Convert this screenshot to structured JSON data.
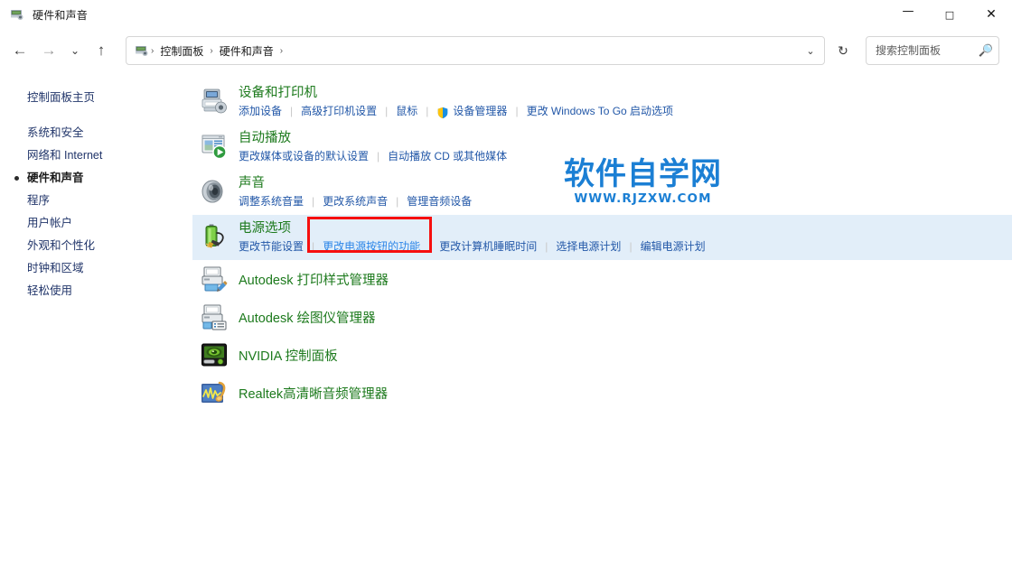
{
  "window": {
    "title": "硬件和声音",
    "icon": "control-panel-icon",
    "controls": {
      "minimize": "—",
      "maximize": "□",
      "close": "✕"
    }
  },
  "navbar": {
    "back": "←",
    "forward": "→",
    "recent": "⌄",
    "up": "↑",
    "address": {
      "icon": "control-panel-icon",
      "crumbs": [
        "控制面板",
        "硬件和声音"
      ],
      "separator": "›",
      "trailing_separator": "›",
      "dropdown": "⌄"
    },
    "refresh": "↻",
    "search": {
      "placeholder": "搜索控制面板",
      "value": "",
      "icon": "search-icon"
    }
  },
  "sidebar": {
    "home": "控制面板主页",
    "items": [
      {
        "label": "系统和安全",
        "current": false
      },
      {
        "label": "网络和 Internet",
        "current": false
      },
      {
        "label": "硬件和声音",
        "current": true
      },
      {
        "label": "程序",
        "current": false
      },
      {
        "label": "用户帐户",
        "current": false
      },
      {
        "label": "外观和个性化",
        "current": false
      },
      {
        "label": "时钟和区域",
        "current": false
      },
      {
        "label": "轻松使用",
        "current": false
      }
    ]
  },
  "main": {
    "categories": [
      {
        "icon": "devices-and-printers-icon",
        "title": "设备和打印机",
        "links": [
          {
            "label": "添加设备",
            "shield": false
          },
          {
            "label": "高级打印机设置",
            "shield": false
          },
          {
            "label": "鼠标",
            "shield": false
          },
          {
            "label": "设备管理器",
            "shield": true
          },
          {
            "label": "更改 Windows To Go 启动选项",
            "shield": false
          }
        ],
        "highlight": false
      },
      {
        "icon": "autoplay-icon",
        "title": "自动播放",
        "links": [
          {
            "label": "更改媒体或设备的默认设置",
            "shield": false
          },
          {
            "label": "自动播放 CD 或其他媒体",
            "shield": false
          }
        ],
        "highlight": false
      },
      {
        "icon": "sound-icon",
        "title": "声音",
        "links": [
          {
            "label": "调整系统音量",
            "shield": false
          },
          {
            "label": "更改系统声音",
            "shield": false
          },
          {
            "label": "管理音频设备",
            "shield": false
          }
        ],
        "highlight": false
      },
      {
        "icon": "power-options-icon",
        "title": "电源选项",
        "links": [
          {
            "label": "更改节能设置",
            "shield": false
          },
          {
            "label": "更改电源按钮的功能",
            "shield": false,
            "hovered": true
          },
          {
            "label": "更改计算机睡眠时间",
            "shield": false
          },
          {
            "label": "选择电源计划",
            "shield": false
          },
          {
            "label": "编辑电源计划",
            "shield": false
          }
        ],
        "highlight": true
      }
    ],
    "applets": [
      {
        "icon": "autodesk-plot-style-icon",
        "label": "Autodesk 打印样式管理器"
      },
      {
        "icon": "autodesk-plotter-icon",
        "label": "Autodesk 绘图仪管理器"
      },
      {
        "icon": "nvidia-icon",
        "label": "NVIDIA 控制面板"
      },
      {
        "icon": "realtek-audio-icon",
        "label": "Realtek高清晰音频管理器"
      }
    ],
    "separator": "|"
  },
  "watermark": {
    "cn": "软件自学网",
    "en": "WWW.RJZXW.COM",
    "color": "#1b7fd4"
  },
  "annotation": {
    "target_label": "更改电源按钮的功能",
    "color": "#f60f0f"
  },
  "colors": {
    "category_title": "#1d7a1d",
    "link": "#2358a8",
    "link_hovered": "#2b85e8",
    "highlight_row": "#e2eef9",
    "sidebar_link": "#21356a"
  }
}
